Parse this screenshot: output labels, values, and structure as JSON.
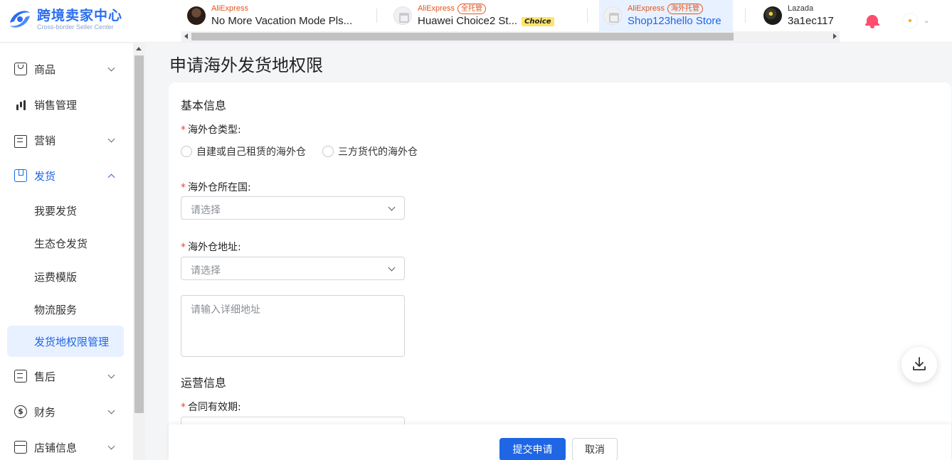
{
  "header": {
    "logo_title": "跨境卖家中心",
    "logo_subtitle": "Cross-border Seller Center",
    "shops": [
      {
        "platform": "AliExpress",
        "tag": "",
        "name": "No More Vacation Mode Pls...",
        "choice": "",
        "avatar": "dark"
      },
      {
        "platform": "AliExpress",
        "tag": "全托管",
        "name": "Huawei Choice2 St...",
        "choice": "Choice",
        "avatar": "store"
      },
      {
        "platform": "AliExpress",
        "tag": "海外托管",
        "name": "Shop123hello Store",
        "choice": "",
        "avatar": "store"
      },
      {
        "platform": "Lazada",
        "tag": "",
        "name": "3a1ec117",
        "choice": "",
        "avatar": "gold"
      }
    ],
    "icons": {
      "notification": "bell-icon",
      "user": "user-avatar"
    }
  },
  "sidebar": {
    "items": [
      {
        "label": "商品",
        "icon": "bag-icon"
      },
      {
        "label": "销售管理",
        "icon": "bar-chart-icon"
      },
      {
        "label": "营销",
        "icon": "megaphone-icon"
      },
      {
        "label": "发货",
        "icon": "box-icon"
      },
      {
        "label": "售后",
        "icon": "document-icon"
      },
      {
        "label": "财务",
        "icon": "coin-icon"
      },
      {
        "label": "店铺信息",
        "icon": "shop-icon"
      }
    ],
    "sub_items": [
      {
        "label": "我要发货"
      },
      {
        "label": "生态仓发货"
      },
      {
        "label": "运费模版"
      },
      {
        "label": "物流服务"
      },
      {
        "label": "发货地权限管理"
      }
    ]
  },
  "main": {
    "title": "申请海外发货地权限",
    "basic_info": "基本信息",
    "warehouse_type": {
      "label": "海外仓类型:",
      "options": [
        "自建或自己租赁的海外仓",
        "三方货代的海外仓"
      ]
    },
    "country": {
      "label": "海外仓所在国:",
      "placeholder": "请选择"
    },
    "address": {
      "label": "海外仓地址:",
      "placeholder": "请选择",
      "detail_placeholder": "请输入详细地址"
    },
    "ops_info": "运营信息",
    "contract": {
      "label": "合同有效期:"
    }
  },
  "footer": {
    "submit": "提交申请",
    "cancel": "取消"
  },
  "colors": {
    "primary": "#1f66e5",
    "required": "#f5412d",
    "aliexpress": "#e2541d"
  }
}
